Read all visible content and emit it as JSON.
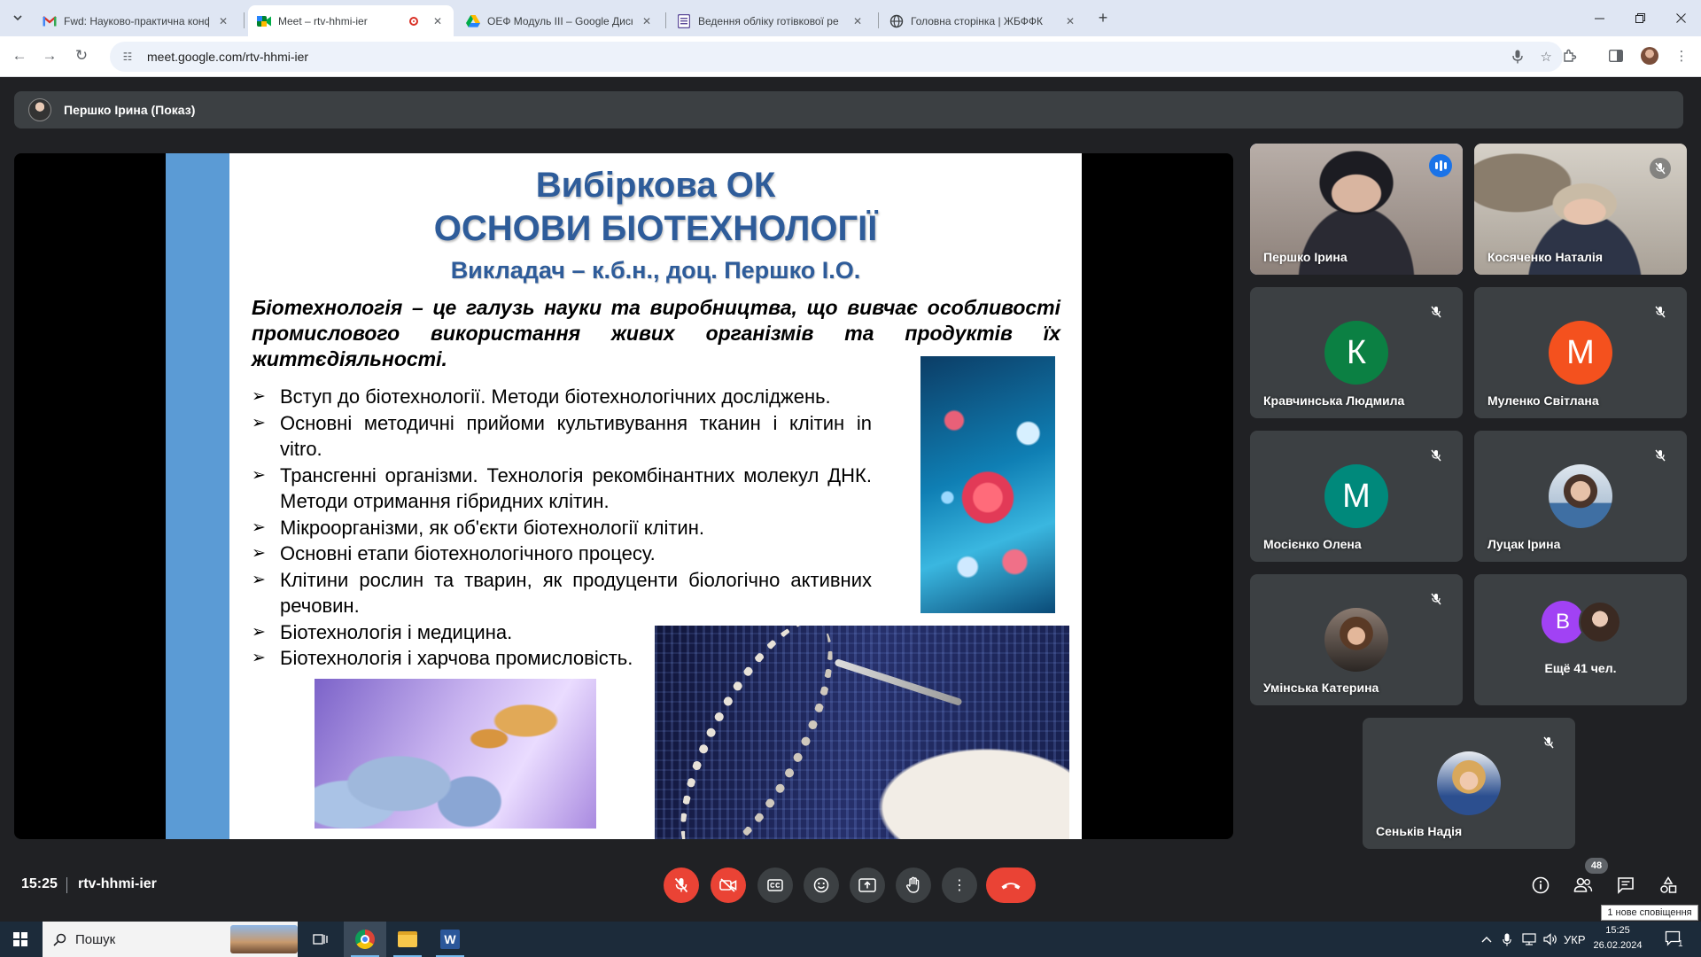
{
  "browser": {
    "tabs": [
      {
        "label": "Fwd: Науково-практична конф",
        "favicon": "gmail-icon"
      },
      {
        "label": "Meet – rtv-hhmi-ier",
        "favicon": "meet-icon",
        "active": true,
        "recording": true
      },
      {
        "label": "ОЕФ Модуль ІІІ – Google Диск",
        "favicon": "drive-icon"
      },
      {
        "label": "Ведення обліку готівкової ре",
        "favicon": "docs-icon"
      },
      {
        "label": "Головна сторінка | ЖБФФК",
        "favicon": "globe-icon"
      }
    ],
    "url": "meet.google.com/rtv-hhmi-ier"
  },
  "meet": {
    "presenter_label": "Першко Ірина (Показ)",
    "time": "15:25",
    "meeting_code": "rtv-hhmi-ier",
    "people_count": "48",
    "notification_tooltip": "1 нове сповіщення",
    "participants": [
      {
        "name": "Першко Ірина",
        "type": "video",
        "speaking": true
      },
      {
        "name": "Косяченко Наталія",
        "type": "video",
        "muted": true
      },
      {
        "name": "Кравчинська Людмила",
        "type": "letter",
        "letter": "К",
        "color": "#0b8043",
        "muted": true
      },
      {
        "name": "Муленко Світлана",
        "type": "letter",
        "letter": "М",
        "color": "#f4511e",
        "muted": true
      },
      {
        "name": "Мосієнко Олена",
        "type": "letter",
        "letter": "М",
        "color": "#00897b",
        "muted": true
      },
      {
        "name": "Луцак Ірина",
        "type": "photo",
        "muted": true
      },
      {
        "name": "Умінська Катерина",
        "type": "photo",
        "muted": true
      },
      {
        "name": "Сеньків Надія",
        "type": "photo",
        "muted": true
      }
    ],
    "more": {
      "letter": "В",
      "label": "Ещё 41 чел."
    }
  },
  "slide": {
    "title1": "Вибіркова ОК",
    "title2": "ОСНОВИ БІОТЕХНОЛОГІЇ",
    "subtitle": "Викладач – к.б.н., доц. Першко І.О.",
    "definition": "Біотехнологія – це галузь науки та виробництва, що вивчає особливості промислового використання живих організмів та продуктів їх життєдіяльності.",
    "bullets": [
      "Вступ до біотехнології. Методи біотехнологічних досліджень.",
      "Основні методичні прийоми культивування тканин і клітин in vitro.",
      "Трансгенні організми. Технологія рекомбінантних молекул ДНК. Методи отримання гібридних клітин.",
      "Мікроорганізми, як об'єкти біотехнології клітин.",
      "Основні етапи біотехнологічного процесу.",
      "Клітини рослин та тварин, як продуценти біологічно активних речовин.",
      "Біотехнологія і медицина.",
      "Біотехнологія і харчова промисловість."
    ]
  },
  "taskbar": {
    "search_label": "Пошук",
    "language": "УКР",
    "clock_time": "15:25",
    "clock_date": "26.02.2024",
    "notif_count": "1"
  },
  "colors": {
    "meet_bg": "#202124",
    "tile_bg": "#3c4043",
    "danger": "#ea4335",
    "accent": "#8ab4f8",
    "slide_title": "#2e5c9a",
    "slide_bar": "#5b9bd5"
  }
}
